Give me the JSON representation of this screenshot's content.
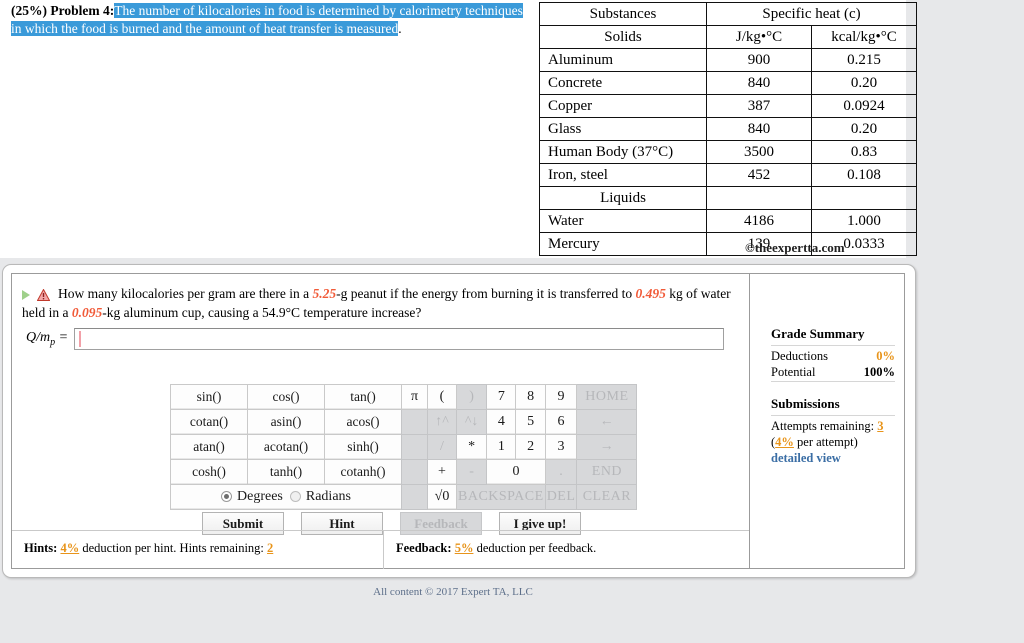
{
  "problem": {
    "lead": "(25%) Problem 4:",
    "selected_text": "The number of kilocalories in food is determined by calorimetry techniques in which the food is burned and the amount of heat transfer is measured",
    "trailing": "."
  },
  "heat_table": {
    "header_substances": "Substances",
    "header_specific_heat": "Specific heat (c)",
    "unit_si": "J/kg•°C",
    "unit_kcal": "kcal/kg•°C",
    "group_solids": "Solids",
    "group_liquids": "Liquids",
    "rows": [
      {
        "substance": "Aluminum",
        "si": "900",
        "kcal": "0.215"
      },
      {
        "substance": "Concrete",
        "si": "840",
        "kcal": "0.20"
      },
      {
        "substance": "Copper",
        "si": "387",
        "kcal": "0.0924"
      },
      {
        "substance": "Glass",
        "si": "840",
        "kcal": "0.20"
      },
      {
        "substance": "Human Body (37°C)",
        "si": "3500",
        "kcal": "0.83"
      },
      {
        "substance": "Iron, steel",
        "si": "452",
        "kcal": "0.108"
      }
    ],
    "liquid_rows": [
      {
        "substance": "Water",
        "si": "4186",
        "kcal": "1.000"
      },
      {
        "substance": "Mercury",
        "si": "139",
        "kcal": "0.0333"
      }
    ],
    "credit": "©theexpertta.com"
  },
  "question": {
    "part1": "How many kilocalories per gram are there in a ",
    "mass_peanut": "5.25",
    "part2": "-g peanut if the energy from burning it is transferred to ",
    "mass_water": "0.495",
    "part3": " kg of water held in a ",
    "mass_cup": "0.095",
    "part4": "-kg aluminum cup, causing a 54.9°C temperature increase?",
    "answer_label_q": "Q",
    "answer_label_slash": "/",
    "answer_label_m": "m",
    "answer_label_sub": "p",
    "answer_label_eq": " = ",
    "answer_value": "",
    "answer_placeholder": ""
  },
  "calculator": {
    "trig_rows": [
      [
        "sin()",
        "cos()",
        "tan()"
      ],
      [
        "cotan()",
        "asin()",
        "acos()"
      ],
      [
        "atan()",
        "acotan()",
        "sinh()"
      ],
      [
        "cosh()",
        "tanh()",
        "cotanh()"
      ]
    ],
    "angle_mode": {
      "degrees_label": "Degrees",
      "radians_label": "Radians",
      "selected": "Degrees"
    },
    "num_rows": [
      [
        {
          "label": "π",
          "disabled": false,
          "cls": "w-pi"
        },
        {
          "label": "(",
          "disabled": false,
          "cls": "w-op"
        },
        {
          "label": ")",
          "disabled": true,
          "cls": "w-op"
        },
        {
          "label": "7",
          "disabled": false,
          "cls": "w-dig"
        },
        {
          "label": "8",
          "disabled": false,
          "cls": "w-dig"
        },
        {
          "label": "9",
          "disabled": false,
          "cls": "w-dig"
        },
        {
          "label": "HOME",
          "disabled": true,
          "cls": "w-nav"
        }
      ],
      [
        {
          "label": "",
          "disabled": true,
          "cls": "w-pi"
        },
        {
          "label": "↑^",
          "disabled": true,
          "cls": "w-op"
        },
        {
          "label": "^↓",
          "disabled": true,
          "cls": "w-op"
        },
        {
          "label": "4",
          "disabled": false,
          "cls": "w-dig"
        },
        {
          "label": "5",
          "disabled": false,
          "cls": "w-dig"
        },
        {
          "label": "6",
          "disabled": false,
          "cls": "w-dig"
        },
        {
          "label": "←",
          "disabled": true,
          "cls": "w-nav"
        }
      ],
      [
        {
          "label": "",
          "disabled": true,
          "cls": "w-pi"
        },
        {
          "label": "/",
          "disabled": true,
          "cls": "w-op"
        },
        {
          "label": "*",
          "disabled": false,
          "cls": "w-op"
        },
        {
          "label": "1",
          "disabled": false,
          "cls": "w-dig"
        },
        {
          "label": "2",
          "disabled": false,
          "cls": "w-dig"
        },
        {
          "label": "3",
          "disabled": false,
          "cls": "w-dig"
        },
        {
          "label": "→",
          "disabled": true,
          "cls": "w-nav"
        }
      ]
    ],
    "row4": {
      "blank": "",
      "plus": "+",
      "minus": "-",
      "zero": "0",
      "dot": ".",
      "end": "END"
    },
    "row5": {
      "blank": "",
      "sqrt": "√0",
      "backspace": "BACKSPACE",
      "del": "DEL",
      "clear": "CLEAR"
    }
  },
  "actions": {
    "submit": "Submit",
    "hint": "Hint",
    "feedback": "Feedback",
    "give_up": "I give up!"
  },
  "hints_bar": {
    "hints_label": "Hints:",
    "hints_pct": "4%",
    "hints_text": " deduction per hint. Hints remaining: ",
    "hints_remaining": "2",
    "feedback_label": "Feedback:",
    "feedback_pct": "5%",
    "feedback_text": " deduction per feedback."
  },
  "grade_summary": {
    "title": "Grade Summary",
    "deductions_label": "Deductions",
    "deductions_value": "0%",
    "potential_label": "Potential",
    "potential_value": "100%",
    "submissions_title": "Submissions",
    "attempts_label": "Attempts remaining:",
    "attempts_value": "3",
    "per_attempt_open": "(",
    "per_attempt_pct": "4%",
    "per_attempt_close": " per attempt)",
    "detailed_view": "detailed view"
  },
  "footer": {
    "copyright": "All content © 2017 Expert TA, LLC"
  },
  "colors": {
    "selection_blue": "#3a9ad9",
    "value_orange": "#f15a38",
    "accent_orange": "#e8941a",
    "link_blue": "#3b6ea5",
    "page_grey": "#e7e8ea"
  }
}
